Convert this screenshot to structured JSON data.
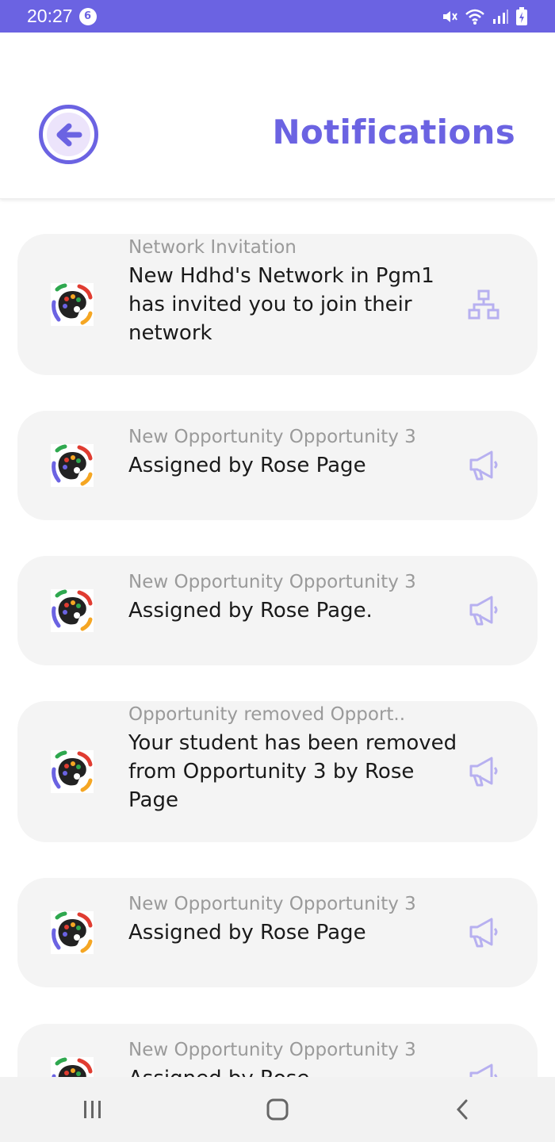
{
  "status_bar": {
    "time": "20:27",
    "notification_count": "6"
  },
  "header": {
    "title": "Notifications",
    "back_icon": "arrow-left-icon"
  },
  "colors": {
    "accent": "#6b63e2",
    "accent_light": "#ece4fb",
    "card_bg": "#f4f4f4",
    "icon_tint": "#b7b0f0"
  },
  "notifications": [
    {
      "category": "Network Invitation",
      "message": "New Hdhd's Network in Pgm1  has invited you to join their network",
      "icon": "network-icon"
    },
    {
      "category": "New Opportunity  Opportunity 3",
      "message": "Assigned by Rose Page",
      "icon": "megaphone-icon"
    },
    {
      "category": "New Opportunity  Opportunity 3",
      "message": "Assigned by Rose Page.",
      "icon": "megaphone-icon"
    },
    {
      "category": "Opportunity removed   Opport..",
      "message": "Your student has been removed from Opportunity 3 by Rose Page",
      "icon": "megaphone-icon"
    },
    {
      "category": "New Opportunity  Opportunity 3",
      "message": "Assigned by Rose Page",
      "icon": "megaphone-icon"
    },
    {
      "category": "New Opportunity  Opportunity 3",
      "message": "Assigned by Rose",
      "icon": "megaphone-icon"
    }
  ],
  "nav_bar": {
    "recents_icon": "recents-icon",
    "home_icon": "home-icon",
    "back_icon": "back-icon"
  }
}
